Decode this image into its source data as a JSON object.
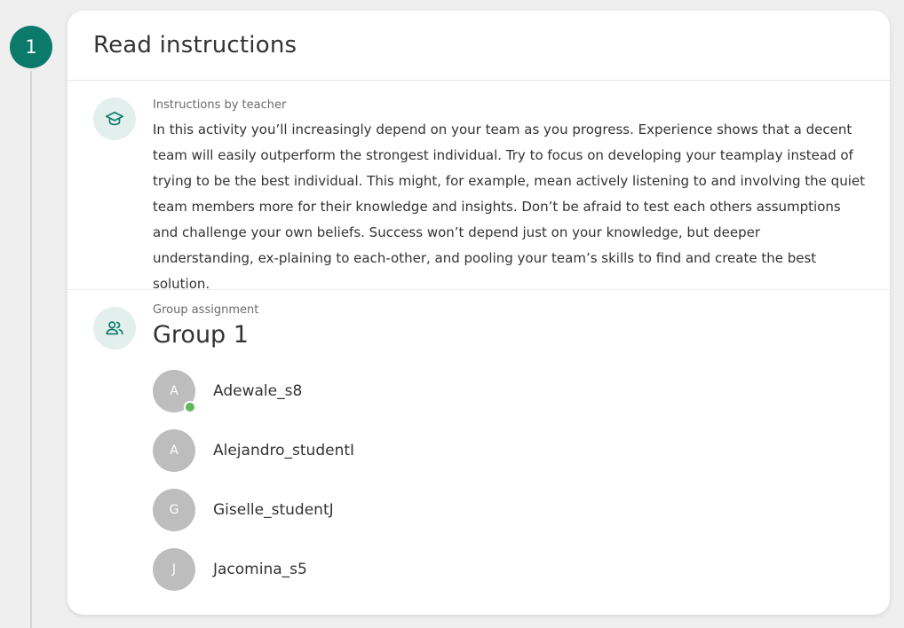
{
  "step": {
    "number": "1",
    "accent_color": "#0b7a6b"
  },
  "card": {
    "title": "Read instructions"
  },
  "instructions": {
    "icon": "graduation-cap-icon",
    "label": "Instructions by teacher",
    "text": "In this activity you’ll increasingly depend on your team as you progress. Experience shows that a decent team will easily outperform the strongest individual. Try to focus on developing your teamplay instead of trying to be the best individual. This might, for example, mean actively listening to and involving the quiet team members more for their knowledge and insights. Don’t be afraid to test each others assumptions and challenge your own beliefs. Success won’t depend just on your knowledge, but deeper understanding, ex-plaining to each-other, and pooling your team’s skills to find and create the best solution."
  },
  "group": {
    "icon": "users-icon",
    "label": "Group assignment",
    "name": "Group 1",
    "members": [
      {
        "initial": "A",
        "name": "Adewale_s8",
        "online": true
      },
      {
        "initial": "A",
        "name": "Alejandro_studentI",
        "online": false
      },
      {
        "initial": "G",
        "name": "Giselle_studentJ",
        "online": false
      },
      {
        "initial": "J",
        "name": "Jacomina_s5",
        "online": false
      }
    ],
    "online_color": "#5fb85c",
    "avatar_color": "#bdbdbd"
  }
}
